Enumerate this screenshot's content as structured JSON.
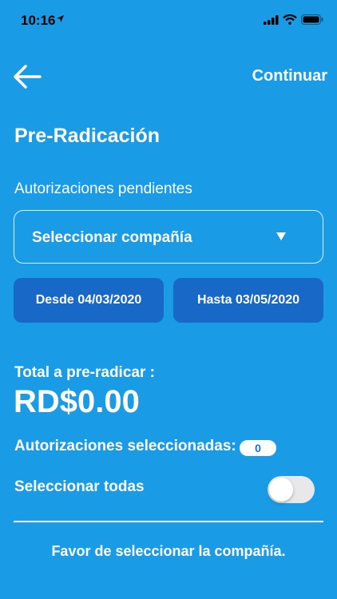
{
  "status": {
    "time": "10:16"
  },
  "header": {
    "continue_label": "Continuar"
  },
  "page": {
    "title": "Pre-Radicación",
    "section_label": "Autorizaciones pendientes"
  },
  "company_select": {
    "value": "Seleccionar compañía"
  },
  "dates": {
    "from": "Desde 04/03/2020",
    "to": "Hasta 03/05/2020"
  },
  "summary": {
    "total_label": "Total a pre-radicar :",
    "total_value": "RD$0.00",
    "selected_label": "Autorizaciones seleccionadas:",
    "selected_count": "0",
    "select_all_label": "Seleccionar todas",
    "select_all_on": false
  },
  "footer": {
    "message": "Favor de seleccionar la compañía."
  },
  "colors": {
    "background": "#1a9be6",
    "date_button": "#1868c8",
    "toggle_off": "#e8e8ea"
  },
  "icons": [
    "location-arrow-icon",
    "signal-icon",
    "wifi-icon",
    "battery-icon",
    "back-arrow-icon",
    "chevron-down-icon"
  ]
}
